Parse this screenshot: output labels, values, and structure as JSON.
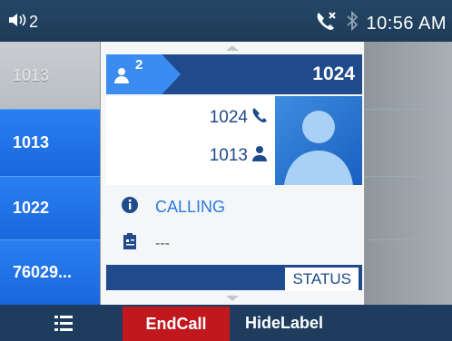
{
  "statusbar": {
    "volume_icon": "speaker-volume-icon",
    "account_number": "2",
    "missed_call_icon": "missed-call-icon",
    "bluetooth_icon": "bluetooth-icon",
    "time": "10:56 AM"
  },
  "lines": [
    {
      "label": "1013",
      "state": "active"
    },
    {
      "label": "1013",
      "state": "normal"
    },
    {
      "label": "1022",
      "state": "normal"
    },
    {
      "label": "76029...",
      "state": "normal"
    }
  ],
  "conference": {
    "participants_icon": "conference-user-icon",
    "participant_count": "2",
    "remote_number": "1024",
    "contact": {
      "remote_label": "1024",
      "remote_icon": "phone-icon",
      "local_label": "1013",
      "local_icon": "user-icon",
      "avatar": "contact-avatar"
    },
    "info_icon": "info-icon",
    "status": "CALLING",
    "badge_icon": "id-badge-icon",
    "detail": "---",
    "status_button": "STATUS"
  },
  "softkeys": {
    "menu_icon": "menu-list-icon",
    "endcall": "EndCall",
    "hidelabel": "HideLabel"
  },
  "colors": {
    "statusbar_bg": "#244665",
    "line_blue": "#1967dd",
    "header_blue": "#1f4a8c",
    "endcall_red": "#c0181d",
    "calling_text": "#2a7ae0"
  }
}
